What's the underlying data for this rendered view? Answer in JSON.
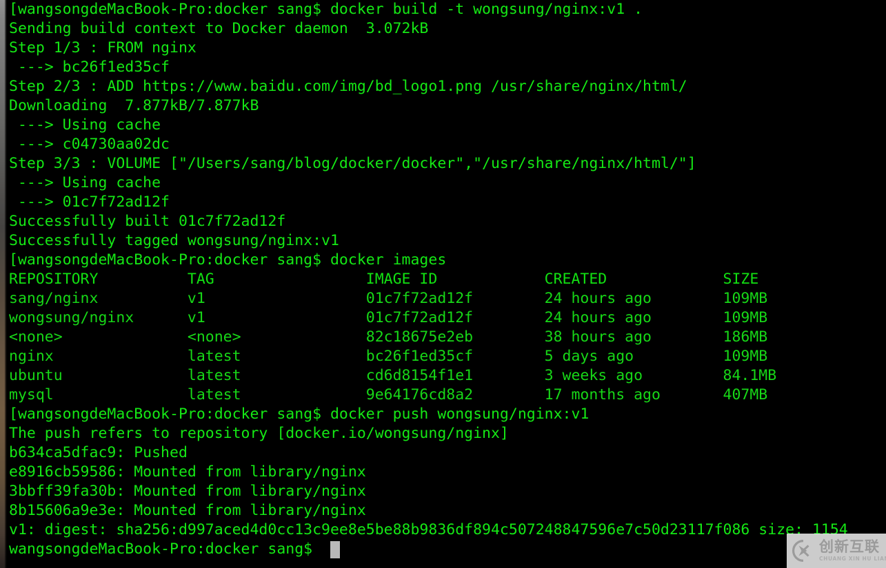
{
  "terminal": {
    "background_color": "#000000",
    "text_color": "#10e010",
    "cursor_color": "#b9b9b9",
    "prompt": "[wangsongdeMacBook-Pro:docker sang$ ",
    "lines": [
      {
        "id": "line-01",
        "kind": "prompt",
        "text": "[wangsongdeMacBook-Pro:docker sang$ docker build -t wongsung/nginx:v1 ."
      },
      {
        "id": "line-02",
        "kind": "output",
        "text": "Sending build context to Docker daemon  3.072kB"
      },
      {
        "id": "line-03",
        "kind": "output",
        "text": "Step 1/3 : FROM nginx"
      },
      {
        "id": "line-04",
        "kind": "output",
        "text": " ---> bc26f1ed35cf"
      },
      {
        "id": "line-05",
        "kind": "output",
        "text": "Step 2/3 : ADD https://www.baidu.com/img/bd_logo1.png /usr/share/nginx/html/"
      },
      {
        "id": "line-06",
        "kind": "output",
        "text": "Downloading  7.877kB/7.877kB"
      },
      {
        "id": "line-07",
        "kind": "output",
        "text": " ---> Using cache"
      },
      {
        "id": "line-08",
        "kind": "output",
        "text": " ---> c04730aa02dc"
      },
      {
        "id": "line-09",
        "kind": "output",
        "text": "Step 3/3 : VOLUME [\"/Users/sang/blog/docker/docker\",\"/usr/share/nginx/html/\"]"
      },
      {
        "id": "line-10",
        "kind": "output",
        "text": " ---> Using cache"
      },
      {
        "id": "line-11",
        "kind": "output",
        "text": " ---> 01c7f72ad12f"
      },
      {
        "id": "line-12",
        "kind": "output",
        "text": "Successfully built 01c7f72ad12f"
      },
      {
        "id": "line-13",
        "kind": "output",
        "text": "Successfully tagged wongsung/nginx:v1"
      },
      {
        "id": "line-14",
        "kind": "prompt",
        "text": "[wangsongdeMacBook-Pro:docker sang$ docker images"
      },
      {
        "id": "line-15",
        "kind": "header",
        "text": "REPOSITORY          TAG                 IMAGE ID            CREATED             SIZE"
      },
      {
        "id": "line-16",
        "kind": "row",
        "text": "sang/nginx          v1                  01c7f72ad12f        24 hours ago        109MB"
      },
      {
        "id": "line-17",
        "kind": "row",
        "text": "wongsung/nginx      v1                  01c7f72ad12f        24 hours ago        109MB"
      },
      {
        "id": "line-18",
        "kind": "row",
        "text": "<none>              <none>              82c18675e2eb        38 hours ago        186MB"
      },
      {
        "id": "line-19",
        "kind": "row",
        "text": "nginx               latest              bc26f1ed35cf        5 days ago          109MB"
      },
      {
        "id": "line-20",
        "kind": "row",
        "text": "ubuntu              latest              cd6d8154f1e1        3 weeks ago         84.1MB"
      },
      {
        "id": "line-21",
        "kind": "row",
        "text": "mysql               latest              9e64176cd8a2        17 months ago       407MB"
      },
      {
        "id": "line-22",
        "kind": "prompt",
        "text": "[wangsongdeMacBook-Pro:docker sang$ docker push wongsung/nginx:v1"
      },
      {
        "id": "line-23",
        "kind": "output",
        "text": "The push refers to repository [docker.io/wongsung/nginx]"
      },
      {
        "id": "line-24",
        "kind": "output",
        "text": "b634ca5dfac9: Pushed"
      },
      {
        "id": "line-25",
        "kind": "output",
        "text": "e8916cb59586: Mounted from library/nginx"
      },
      {
        "id": "line-26",
        "kind": "output",
        "text": "3bbff39fa30b: Mounted from library/nginx"
      },
      {
        "id": "line-27",
        "kind": "output",
        "text": "8b15606a9e3e: Mounted from library/nginx"
      },
      {
        "id": "line-28",
        "kind": "output",
        "text": "v1: digest: sha256:d997aced4d0cc13c9ee8e5be88b9836df894c507248847596e7c50d23117f086 size: 1154"
      },
      {
        "id": "line-29",
        "kind": "prompt",
        "text": "wangsongdeMacBook-Pro:docker sang$ "
      }
    ],
    "images_table": {
      "columns": [
        "REPOSITORY",
        "TAG",
        "IMAGE ID",
        "CREATED",
        "SIZE"
      ],
      "rows": [
        [
          "sang/nginx",
          "v1",
          "01c7f72ad12f",
          "24 hours ago",
          "109MB"
        ],
        [
          "wongsung/nginx",
          "v1",
          "01c7f72ad12f",
          "24 hours ago",
          "109MB"
        ],
        [
          "<none>",
          "<none>",
          "82c18675e2eb",
          "38 hours ago",
          "186MB"
        ],
        [
          "nginx",
          "latest",
          "bc26f1ed35cf",
          "5 days ago",
          "109MB"
        ],
        [
          "ubuntu",
          "latest",
          "cd6d8154f1e1",
          "3 weeks ago",
          "84.1MB"
        ],
        [
          "mysql",
          "latest",
          "9e64176cd8a2",
          "17 months ago",
          "407MB"
        ]
      ]
    },
    "commands": [
      "docker build -t wongsung/nginx:v1 .",
      "docker images",
      "docker push wongsung/nginx:v1"
    ]
  },
  "watermark": {
    "logo_name": "circle-x-logo-icon",
    "cn_text": "创新互联",
    "pinyin_text": "CHUANG XIN HU LIAN",
    "panel_color": "#eeeeee",
    "mark_color": "#9b9b9b"
  }
}
